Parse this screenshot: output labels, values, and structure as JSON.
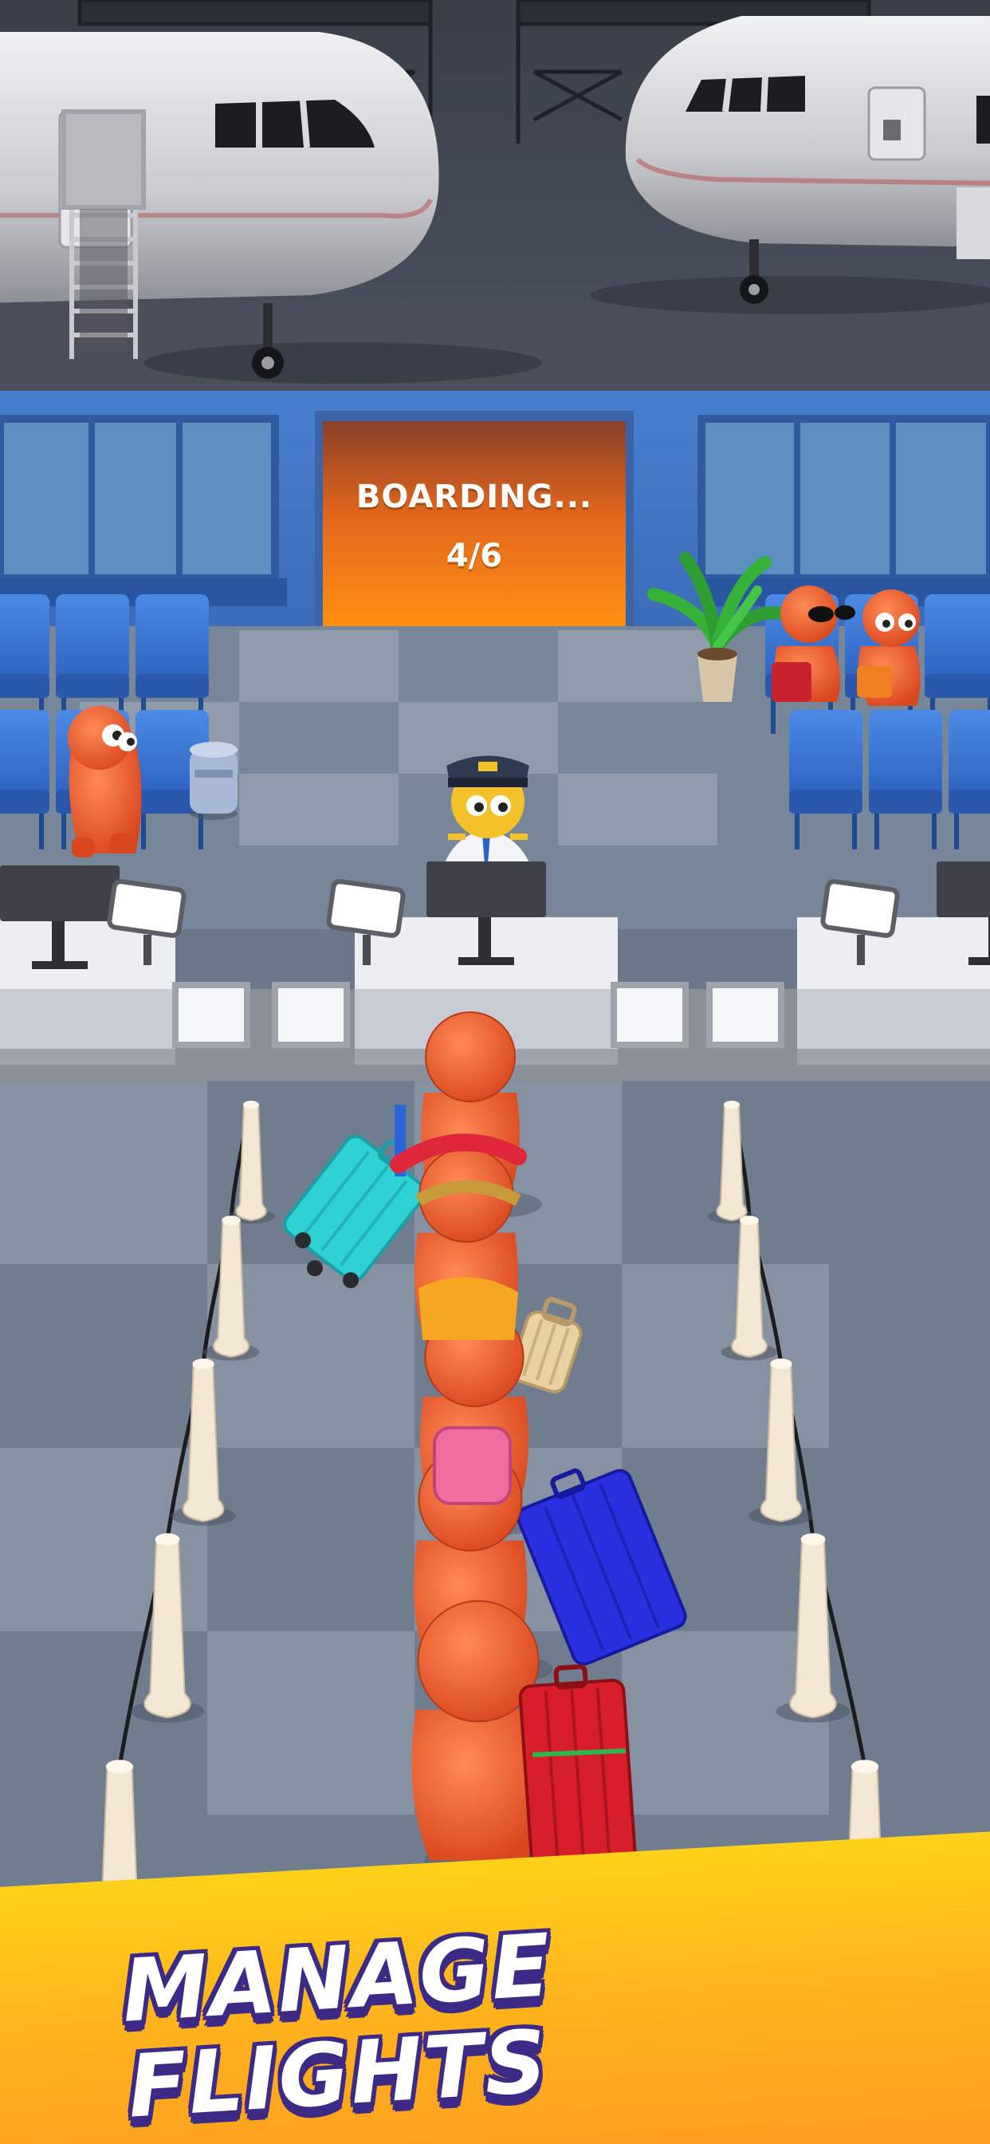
{
  "gate_screen": {
    "status_text": "BOARDING...",
    "progress_text": "4/6",
    "boarded": 4,
    "capacity": 6
  },
  "banner": {
    "caption": "MANAGE FLIGHTS"
  },
  "colors": {
    "accent_orange": "#ff8a1a",
    "passenger_orange": "#f0642c",
    "banner_yellow": "#ffc61e",
    "banner_outline": "#3c2a86",
    "seat_blue": "#3a78d6",
    "floor_gray": "#6f7d8f"
  },
  "icons": [
    "airplane-icon",
    "boarding-stairs-icon",
    "palm-plant-icon",
    "computer-monitor-icon",
    "suitcase-icon"
  ]
}
